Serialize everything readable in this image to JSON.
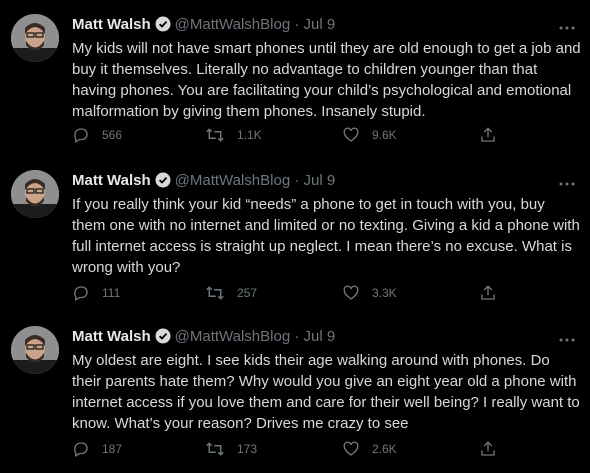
{
  "tweets": [
    {
      "name": "Matt Walsh",
      "handle": "@MattWalshBlog",
      "time": "· Jul 9",
      "text": "My kids will not have smart phones until they are old enough to get a job and buy it themselves. Literally no advantage to children younger than that having phones. You are facilitating your child’s psychological and emotional malformation by giving them phones. Insanely stupid.",
      "replies": "566",
      "retweets": "1.1K",
      "likes": "9.6K"
    },
    {
      "name": "Matt Walsh",
      "handle": "@MattWalshBlog",
      "time": "· Jul 9",
      "text": "If you really think your kid “needs” a phone to get in touch with you, buy them one with no internet and limited or no texting. Giving a kid a phone with full internet access is straight up neglect. I mean there’s no excuse. What is wrong with you?",
      "replies": "111",
      "retweets": "257",
      "likes": "3.3K"
    },
    {
      "name": "Matt Walsh",
      "handle": "@MattWalshBlog",
      "time": "· Jul 9",
      "text": "My oldest are eight. I see kids their age walking around with phones. Do their parents hate them? Why would you give an eight year old a phone with internet access if you love them and care for their well being? I really want to know. What’s your reason? Drives me crazy to see",
      "replies": "187",
      "retweets": "173",
      "likes": "2.6K"
    }
  ],
  "icons": {
    "verified": "verified-badge-icon",
    "more": "more-dots-icon",
    "reply": "reply-icon",
    "retweet": "retweet-icon",
    "like": "heart-icon",
    "share": "share-icon"
  },
  "colors": {
    "background": "#000000",
    "text": "#d9d9d9",
    "muted": "#6e767d",
    "verified": "#d9d9d9"
  }
}
